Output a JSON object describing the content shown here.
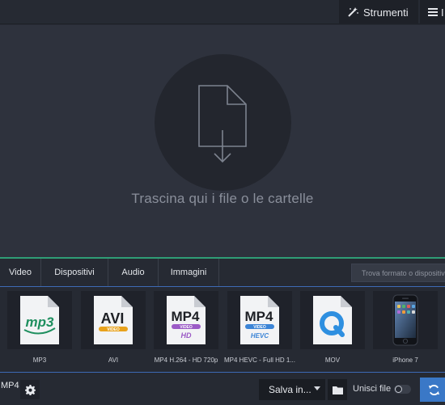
{
  "topbar": {
    "tools_label": "Strumenti",
    "menu_label": "I"
  },
  "dropzone": {
    "hint": "Trascina qui i file o le cartelle"
  },
  "tabs": [
    {
      "label": "Video"
    },
    {
      "label": "Dispositivi"
    },
    {
      "label": "Audio"
    },
    {
      "label": "Immagini"
    }
  ],
  "format_search": {
    "placeholder": "Trova formato o dispositivo"
  },
  "formats": [
    {
      "label": "MP3",
      "icon": "mp3-file-icon",
      "badge": "mp3"
    },
    {
      "label": "AVI",
      "icon": "avi-file-icon",
      "badge": "AVI",
      "sub": "VIDEO"
    },
    {
      "label": "MP4 H.264 - HD 720p",
      "icon": "mp4-hd-file-icon",
      "badge": "MP4",
      "sub": "VIDEO",
      "extra": "HD"
    },
    {
      "label": "MP4 HEVC - Full HD 1...",
      "icon": "mp4-hevc-file-icon",
      "badge": "MP4",
      "sub": "VIDEO",
      "extra": "HEVC"
    },
    {
      "label": "MOV",
      "icon": "quicktime-file-icon"
    },
    {
      "label": "iPhone 7",
      "icon": "iphone-icon"
    }
  ],
  "bottombar": {
    "output_format": "MP4",
    "save_label": "Salva in...",
    "merge_label": "Unisci file",
    "merge_enabled": false
  },
  "colors": {
    "accent_green": "#2f9d76",
    "accent_blue": "#3a78c7",
    "mp3_green": "#1f8f5f",
    "avi_orange": "#e8a21c",
    "mp4_purple": "#9b5ac6",
    "hevc_blue": "#3b84d6",
    "quicktime_blue": "#2e8fe0"
  }
}
